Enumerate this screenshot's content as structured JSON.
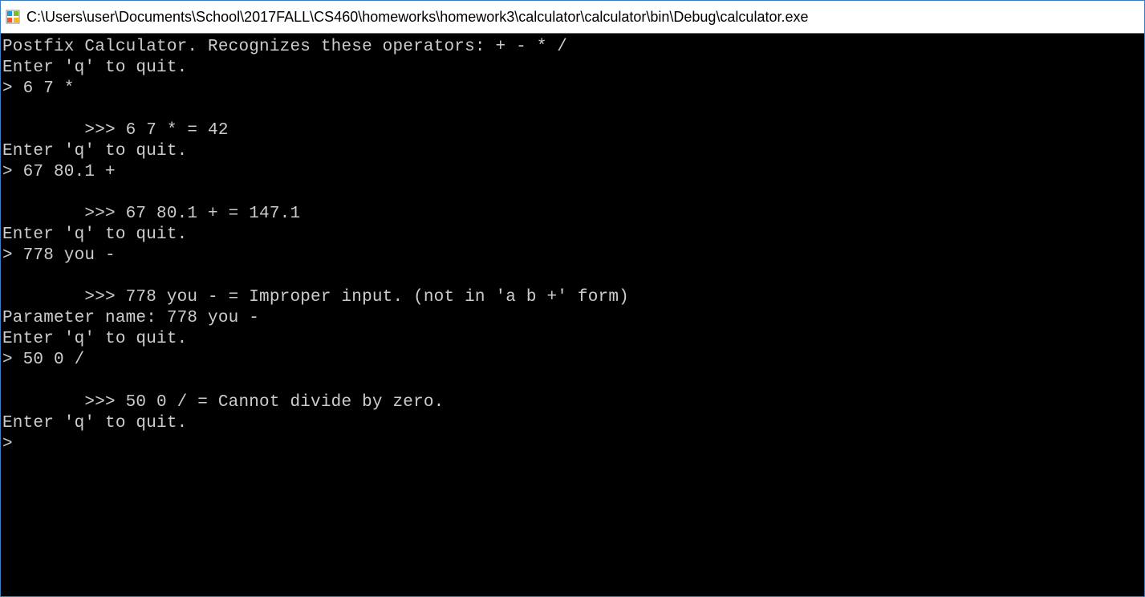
{
  "window": {
    "title": "C:\\Users\\user\\Documents\\School\\2017FALL\\CS460\\homeworks\\homework3\\calculator\\calculator\\bin\\Debug\\calculator.exe"
  },
  "console": {
    "lines": [
      "Postfix Calculator. Recognizes these operators: + - * /",
      "Enter 'q' to quit.",
      "> 6 7 *",
      "",
      "        >>> 6 7 * = 42",
      "Enter 'q' to quit.",
      "> 67 80.1 +",
      "",
      "        >>> 67 80.1 + = 147.1",
      "Enter 'q' to quit.",
      "> 778 you -",
      "",
      "        >>> 778 you - = Improper input. (not in 'a b +' form)",
      "Parameter name: 778 you -",
      "Enter 'q' to quit.",
      "> 50 0 /",
      "",
      "        >>> 50 0 / = Cannot divide by zero.",
      "Enter 'q' to quit.",
      ">"
    ]
  }
}
